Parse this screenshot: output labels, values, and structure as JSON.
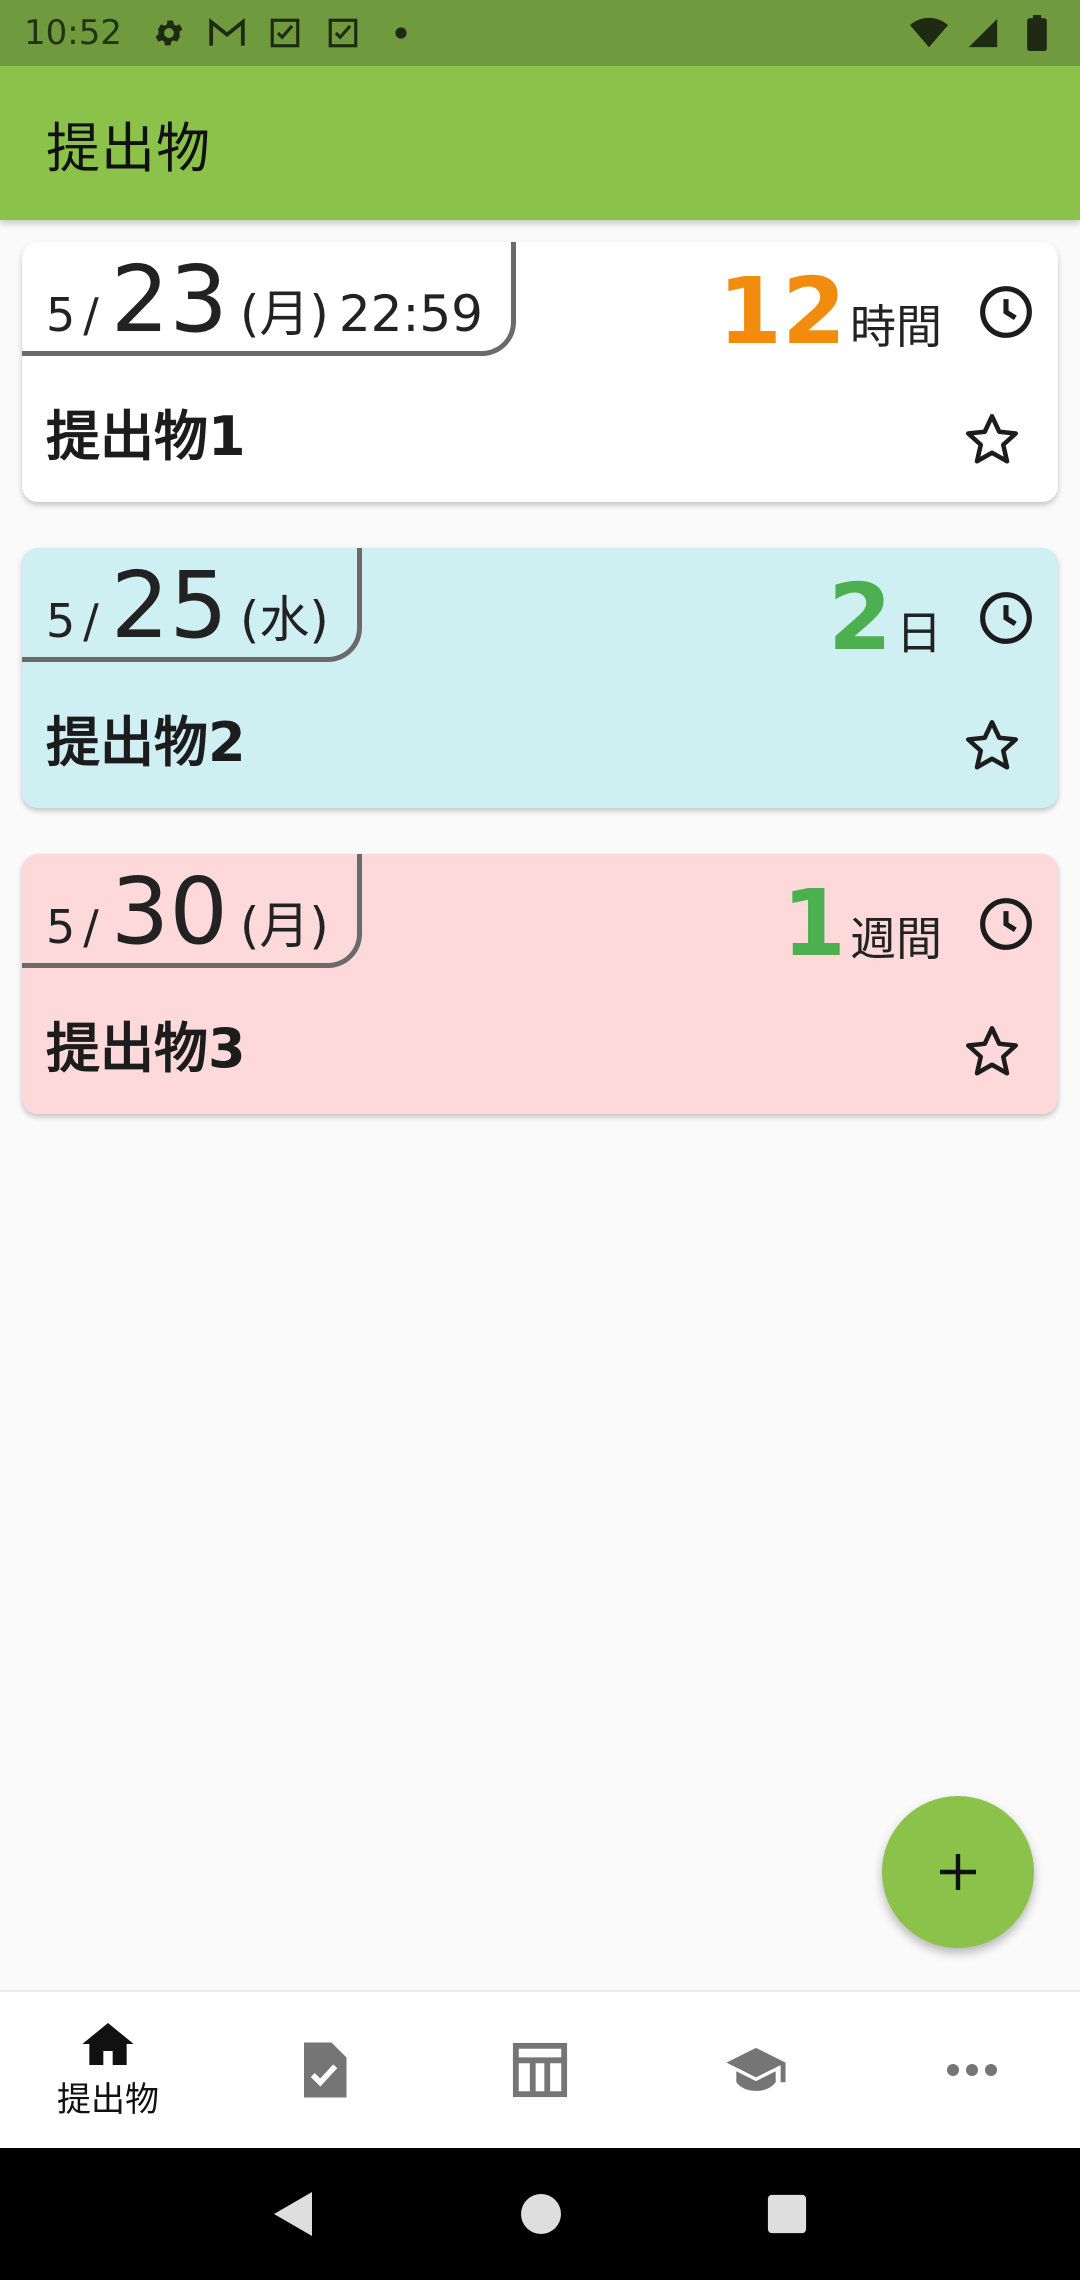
{
  "status_bar": {
    "time": "10:52",
    "left_icons": [
      "gear-icon",
      "gmail-icon",
      "checkbox-icon",
      "checkbox-icon",
      "dot-icon"
    ],
    "right_icons": [
      "wifi-icon",
      "signal-icon",
      "battery-icon"
    ]
  },
  "app_bar": {
    "title": "提出物"
  },
  "accent_color": "#8bc34a",
  "cards": [
    {
      "month": "5",
      "sep": "/",
      "day": "23",
      "weekday": "(月)",
      "time": "22:59",
      "remain_num": "12",
      "remain_unit": "時間",
      "remain_color": "#f28c0f",
      "title": "提出物1",
      "bg": "#ffffff"
    },
    {
      "month": "5",
      "sep": "/",
      "day": "25",
      "weekday": "(水)",
      "time": "",
      "remain_num": "2",
      "remain_unit": "日",
      "remain_color": "#4caf50",
      "title": "提出物2",
      "bg": "#cff0f3"
    },
    {
      "month": "5",
      "sep": "/",
      "day": "30",
      "weekday": "(月)",
      "time": "",
      "remain_num": "1",
      "remain_unit": "週間",
      "remain_color": "#4caf50",
      "title": "提出物3",
      "bg": "#fdd9d9"
    }
  ],
  "fab": {
    "icon": "plus-icon"
  },
  "bottom_nav": {
    "items": [
      {
        "icon": "home-icon",
        "label": "提出物",
        "active": true
      },
      {
        "icon": "task-file-icon",
        "label": ""
      },
      {
        "icon": "timetable-icon",
        "label": ""
      },
      {
        "icon": "school-icon",
        "label": ""
      },
      {
        "icon": "more-icon",
        "label": ""
      }
    ]
  },
  "system_nav": [
    "back-icon",
    "home-circle-icon",
    "recents-icon"
  ]
}
